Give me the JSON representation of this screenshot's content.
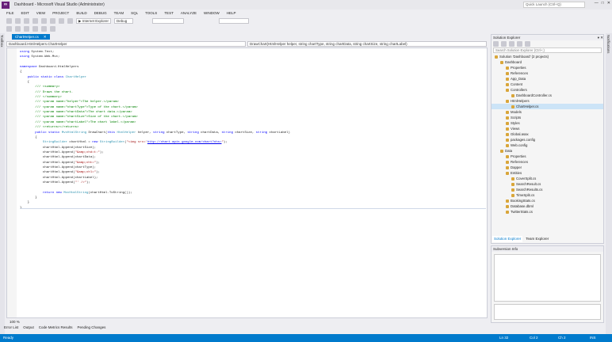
{
  "window": {
    "title": "Dashboard - Microsoft Visual Studio (Administrator)",
    "quick_launch": "Quick Launch (Ctrl+Q)",
    "min": "—",
    "max": "□",
    "close": "✕"
  },
  "menu": [
    "FILE",
    "EDIT",
    "VIEW",
    "PROJECT",
    "BUILD",
    "DEBUG",
    "TEAM",
    "SQL",
    "TOOLS",
    "TEST",
    "ANALYZE",
    "WINDOW",
    "HELP"
  ],
  "toolbar": {
    "run_target": "▶ Internet Explorer",
    "config": "Debug"
  },
  "left_strip": "Toolbox",
  "right_strip": "Notifications",
  "doc_tab": {
    "name": "ChartHelper.cs",
    "close": "✕"
  },
  "nav": {
    "left": "Dashboard.HtmlHelpers.ChartHelper",
    "right": "DrawChart(HtmlHelper helper, string chartType, string chartData, string chartSize, string chartLabel)"
  },
  "zoom": "100 %",
  "bottom_tabs": [
    "Error List",
    "Output",
    "Code Metrics Results",
    "Pending Changes"
  ],
  "status": {
    "ready": "Ready",
    "ln": "Ln 32",
    "col": "Col 2",
    "ch": "Ch 2",
    "ins": "INS"
  },
  "solution_explorer": {
    "header": "Solution Explorer",
    "search": "Search Solution Explorer (Ctrl+;)",
    "nodes": [
      {
        "label": "Solution 'Dashboard' (2 projects)",
        "d": 0
      },
      {
        "label": "Dashboard",
        "d": 1
      },
      {
        "label": "Properties",
        "d": 2
      },
      {
        "label": "References",
        "d": 2
      },
      {
        "label": "App_Data",
        "d": 2
      },
      {
        "label": "Content",
        "d": 2
      },
      {
        "label": "Controllers",
        "d": 2
      },
      {
        "label": "DashboardController.cs",
        "d": 3
      },
      {
        "label": "HtmlHelpers",
        "d": 2
      },
      {
        "label": "ChartHelper.cs",
        "d": 3,
        "sel": true
      },
      {
        "label": "Models",
        "d": 2
      },
      {
        "label": "Scripts",
        "d": 2
      },
      {
        "label": "Styles",
        "d": 2
      },
      {
        "label": "Views",
        "d": 2
      },
      {
        "label": "Global.asax",
        "d": 2
      },
      {
        "label": "packages.config",
        "d": 2
      },
      {
        "label": "Web.config",
        "d": 2
      },
      {
        "label": "Data",
        "d": 1
      },
      {
        "label": "Properties",
        "d": 2
      },
      {
        "label": "References",
        "d": 2
      },
      {
        "label": "Dapper",
        "d": 2
      },
      {
        "label": "Entities",
        "d": 2
      },
      {
        "label": "CoverSplit.cs",
        "d": 3
      },
      {
        "label": "SearchResult.cs",
        "d": 3
      },
      {
        "label": "SearchResults.cs",
        "d": 3
      },
      {
        "label": "TimeSplit.cs",
        "d": 3
      },
      {
        "label": "BookingStats.cs",
        "d": 2
      },
      {
        "label": "Database.dbml",
        "d": 2
      },
      {
        "label": "TwitterStats.cs",
        "d": 2
      }
    ],
    "tabs": [
      "Solution Explorer",
      "Team Explorer"
    ]
  },
  "subversion": {
    "header": "Subversion Info"
  }
}
